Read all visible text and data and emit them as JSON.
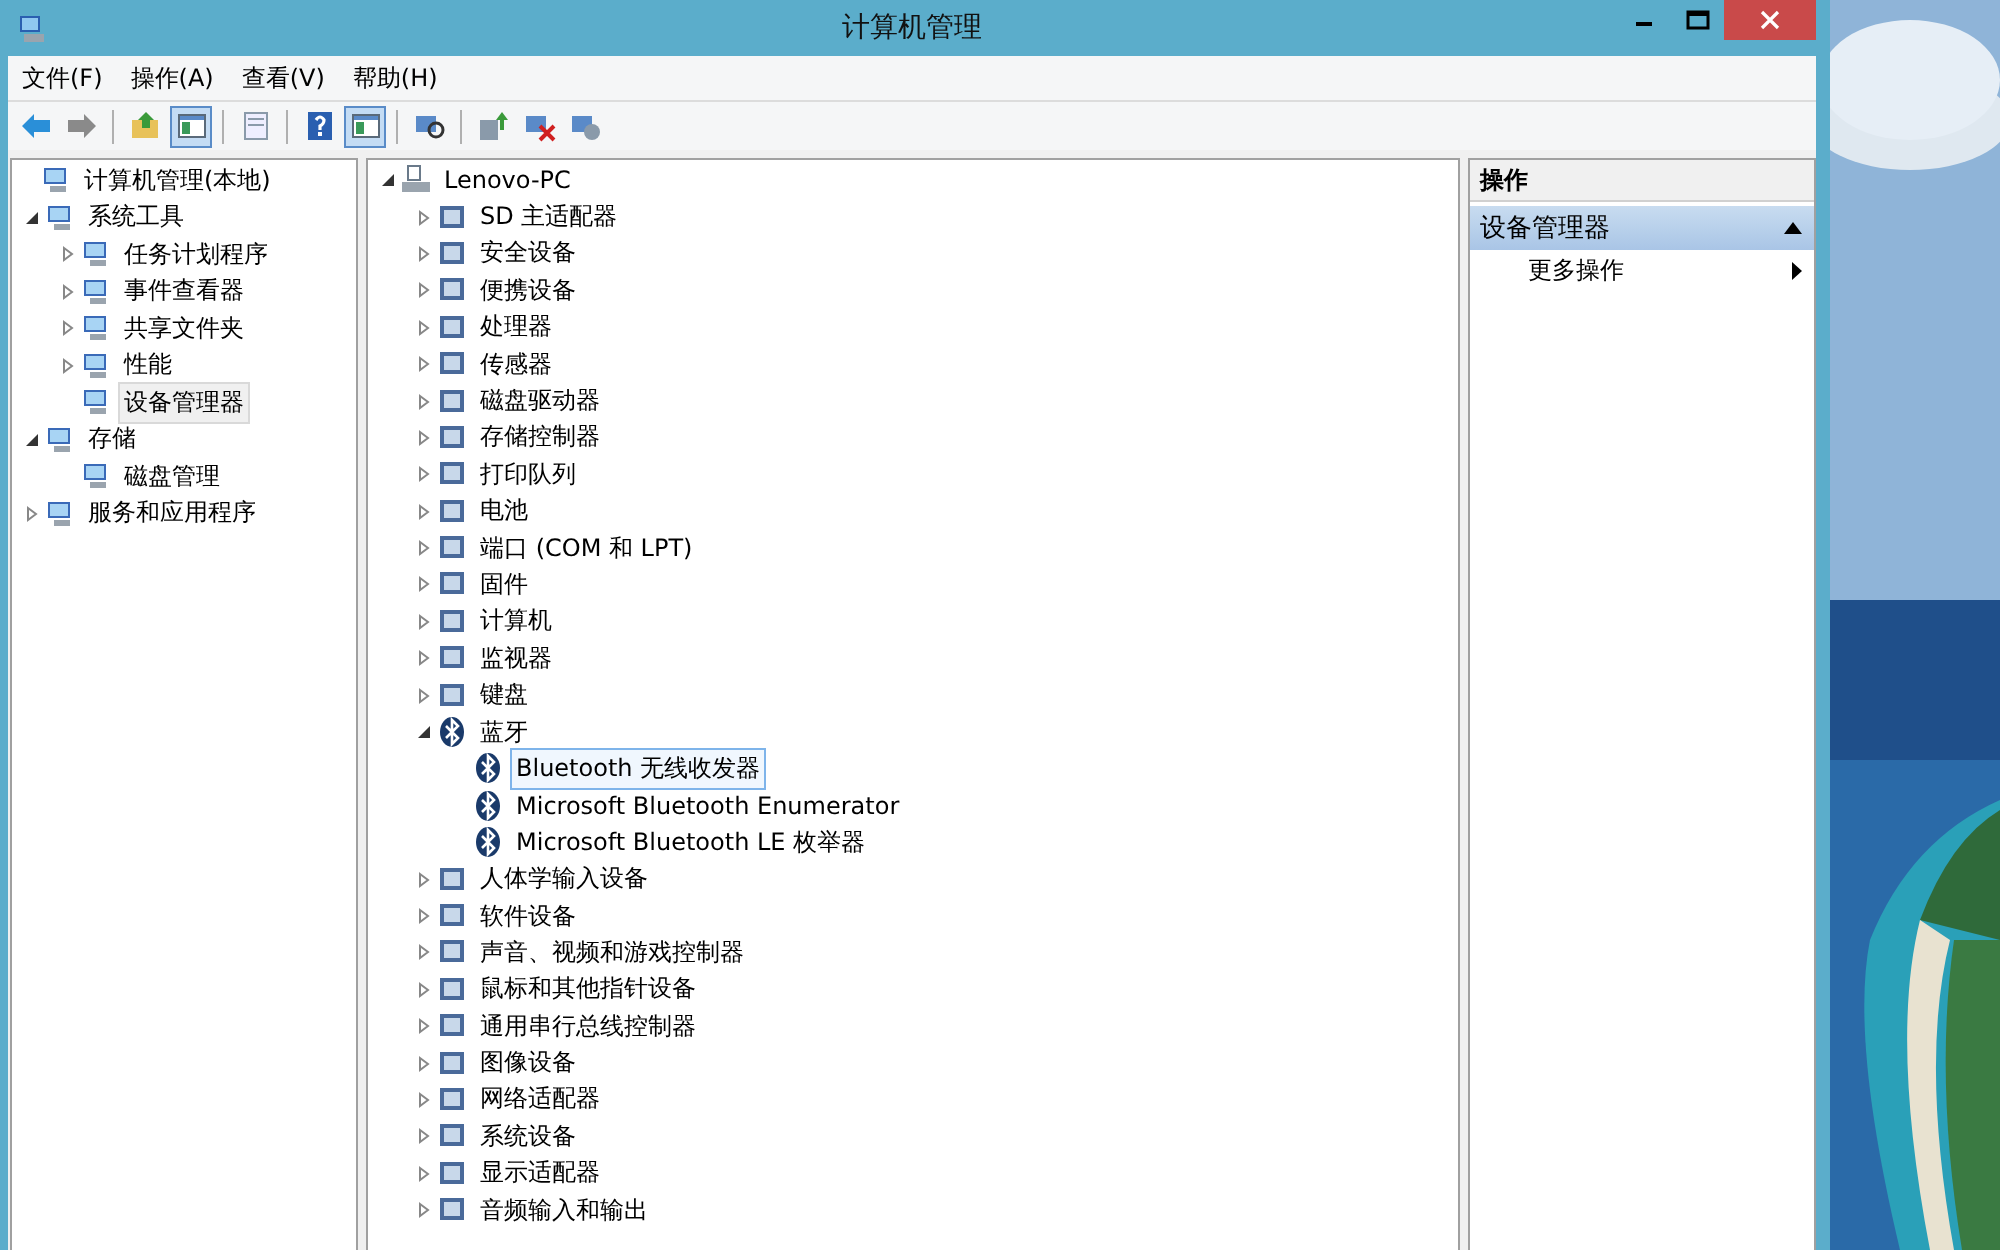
{
  "window": {
    "title": "计算机管理"
  },
  "menu": [
    "文件(F)",
    "操作(A)",
    "查看(V)",
    "帮助(H)"
  ],
  "toolbar": [
    {
      "kind": "back",
      "on": false
    },
    {
      "kind": "forward",
      "on": false
    },
    {
      "kind": "separator"
    },
    {
      "kind": "up",
      "on": false
    },
    {
      "kind": "pane",
      "on": true
    },
    {
      "kind": "separator"
    },
    {
      "kind": "properties",
      "on": false
    },
    {
      "kind": "separator"
    },
    {
      "kind": "help",
      "on": false
    },
    {
      "kind": "pane",
      "on": true
    },
    {
      "kind": "separator"
    },
    {
      "kind": "scan",
      "on": false
    },
    {
      "kind": "separator"
    },
    {
      "kind": "update",
      "on": false
    },
    {
      "kind": "uninstall",
      "on": false
    },
    {
      "kind": "rollback",
      "on": false
    }
  ],
  "console_tree": [
    {
      "label": "计算机管理(本地)",
      "selected": false,
      "children": [
        {
          "label": "系统工具",
          "expanded": true,
          "selected": false,
          "children": [
            {
              "label": "任务计划程序",
              "expanded": false,
              "selected": false
            },
            {
              "label": "事件查看器",
              "expanded": false,
              "selected": false
            },
            {
              "label": "共享文件夹",
              "expanded": false,
              "selected": false
            },
            {
              "label": "性能",
              "expanded": false,
              "selected": false
            },
            {
              "label": "设备管理器",
              "selected": true
            }
          ]
        },
        {
          "label": "存储",
          "expanded": true,
          "selected": false,
          "children": [
            {
              "label": "磁盘管理",
              "selected": false
            }
          ]
        },
        {
          "label": "服务和应用程序",
          "expanded": false,
          "selected": false
        }
      ]
    }
  ],
  "device_tree": [
    {
      "label": "Lenovo-PC",
      "expanded": true,
      "selected": false,
      "children": [
        {
          "label": "SD 主适配器",
          "expanded": false,
          "selected": false
        },
        {
          "label": "安全设备",
          "expanded": false,
          "selected": false
        },
        {
          "label": "便携设备",
          "expanded": false,
          "selected": false
        },
        {
          "label": "处理器",
          "expanded": false,
          "selected": false
        },
        {
          "label": "传感器",
          "expanded": false,
          "selected": false
        },
        {
          "label": "磁盘驱动器",
          "expanded": false,
          "selected": false
        },
        {
          "label": "存储控制器",
          "expanded": false,
          "selected": false
        },
        {
          "label": "打印队列",
          "expanded": false,
          "selected": false
        },
        {
          "label": "电池",
          "expanded": false,
          "selected": false
        },
        {
          "label": "端口 (COM 和 LPT)",
          "expanded": false,
          "selected": false
        },
        {
          "label": "固件",
          "expanded": false,
          "selected": false
        },
        {
          "label": "计算机",
          "expanded": false,
          "selected": false
        },
        {
          "label": "监视器",
          "expanded": false,
          "selected": false
        },
        {
          "label": "键盘",
          "expanded": false,
          "selected": false
        },
        {
          "label": "蓝牙",
          "kind": "bluetooth",
          "expanded": true,
          "selected": false,
          "children": [
            {
              "label": "Bluetooth 无线收发器",
              "kind": "bluetooth",
              "selected": true
            },
            {
              "label": "Microsoft Bluetooth Enumerator",
              "kind": "bluetooth",
              "selected": false
            },
            {
              "label": "Microsoft Bluetooth LE 枚举器",
              "kind": "bluetooth",
              "selected": false
            }
          ]
        },
        {
          "label": "人体学输入设备",
          "expanded": false,
          "selected": false
        },
        {
          "label": "软件设备",
          "expanded": false,
          "selected": false
        },
        {
          "label": "声音、视频和游戏控制器",
          "expanded": false,
          "selected": false
        },
        {
          "label": "鼠标和其他指针设备",
          "expanded": false,
          "selected": false
        },
        {
          "label": "通用串行总线控制器",
          "expanded": false,
          "selected": false
        },
        {
          "label": "图像设备",
          "expanded": false,
          "selected": false
        },
        {
          "label": "网络适配器",
          "expanded": false,
          "selected": false
        },
        {
          "label": "系统设备",
          "expanded": false,
          "selected": false
        },
        {
          "label": "显示适配器",
          "expanded": false,
          "selected": false
        },
        {
          "label": "音频输入和输出",
          "expanded": false,
          "selected": false
        }
      ]
    }
  ],
  "actions": {
    "title": "操作",
    "sections": [
      {
        "title": "设备管理器",
        "expanded": true,
        "items": [
          "更多操作"
        ]
      }
    ]
  }
}
